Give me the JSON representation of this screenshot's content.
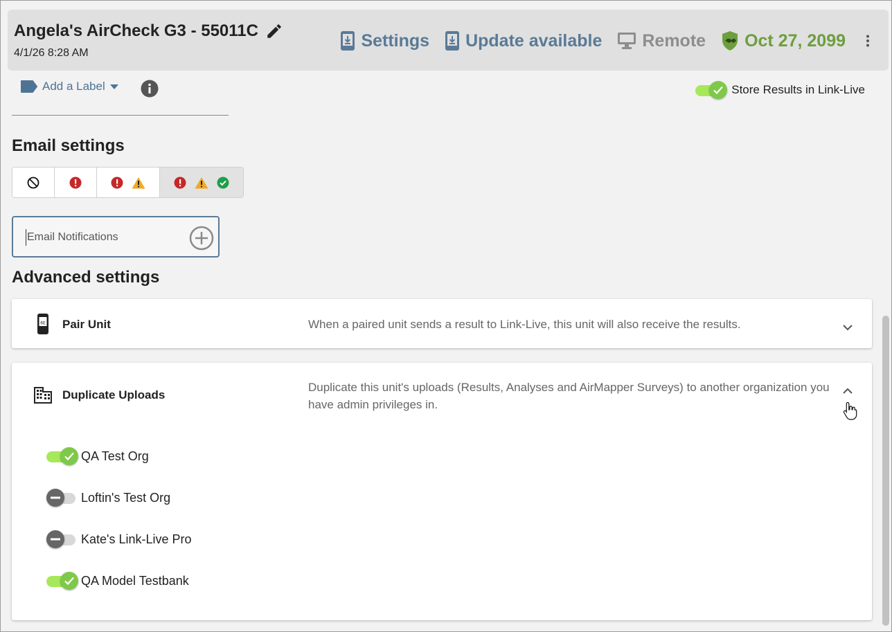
{
  "header": {
    "device_name": "Angela's AirCheck G3 - 55011C",
    "timestamp": "4/1/26 8:28 AM",
    "settings_label": "Settings",
    "update_label": "Update available",
    "remote_label": "Remote",
    "expiry_date": "Oct 27, 2099",
    "icons": {
      "edit": "pencil-icon",
      "settings": "download-device-icon",
      "update": "download-device-icon",
      "remote": "monitor-icon",
      "expiry": "shield-handshake-icon",
      "menu": "more-vertical-icon"
    }
  },
  "label": {
    "add_label": "Add a Label"
  },
  "store_results": {
    "label": "Store Results in Link-Live",
    "enabled": true
  },
  "email_settings": {
    "title": "Email settings",
    "levels": [
      {
        "icons": [
          "block-icon"
        ]
      },
      {
        "icons": [
          "error-icon"
        ]
      },
      {
        "icons": [
          "error-icon",
          "warning-icon"
        ]
      },
      {
        "icons": [
          "error-icon",
          "warning-icon",
          "check-circle-icon"
        ]
      }
    ],
    "selected_level": 3,
    "notifications_placeholder": "Email Notifications"
  },
  "advanced_settings": {
    "title": "Advanced settings",
    "pair_unit": {
      "title": "Pair Unit",
      "description": "When a paired unit sends a result to Link-Live, this unit will also receive the results."
    },
    "duplicate_uploads": {
      "title": "Duplicate Uploads",
      "description": "Duplicate this unit's uploads (Results, Analyses and AirMapper Surveys) to another organization you have admin privileges in.",
      "orgs": [
        {
          "name": "QA Test Org",
          "enabled": true
        },
        {
          "name": "Loftin's Test Org",
          "enabled": false
        },
        {
          "name": "Kate's Link-Live Pro",
          "enabled": false
        },
        {
          "name": "QA Model Testbank",
          "enabled": true
        }
      ]
    }
  },
  "colors": {
    "accent": "#5a7a96",
    "success": "#6d9e3f",
    "toggle_on": "#a6e85a",
    "error": "#c62828",
    "warning": "#f0a824",
    "ok": "#1e9e4a"
  }
}
